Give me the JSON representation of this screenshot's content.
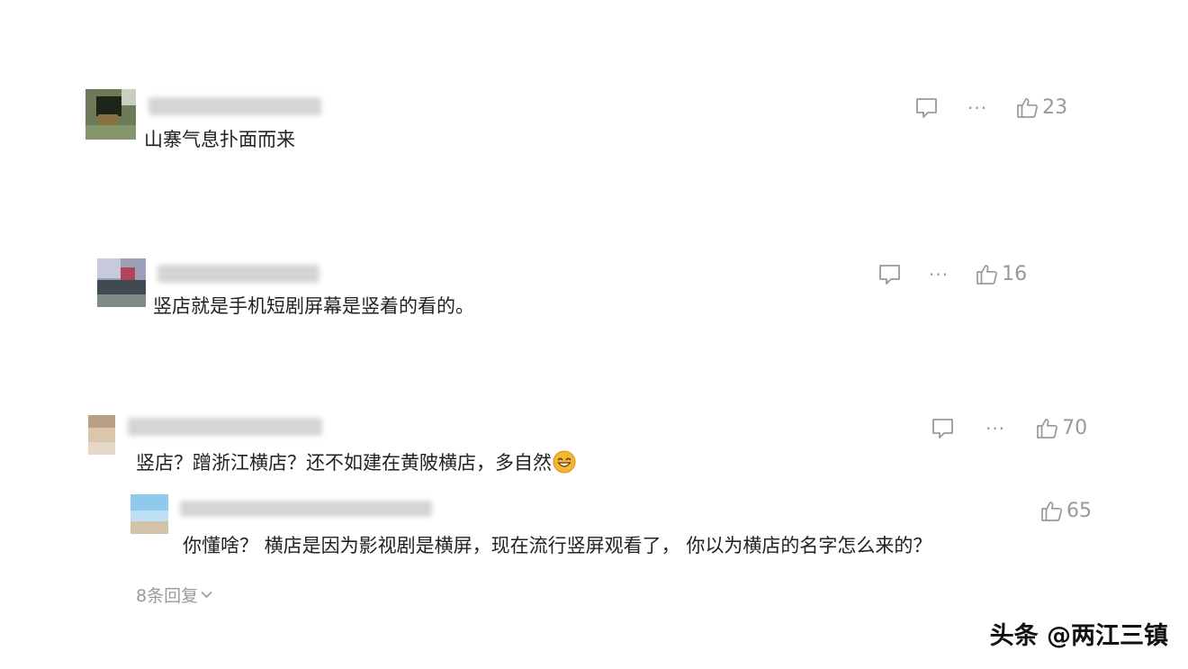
{
  "comments": [
    {
      "text": "山寨气息扑面而来",
      "likes": "23",
      "more_label": "···"
    },
    {
      "text": "竖店就是手机短剧屏幕是竖着的看的。",
      "likes": "16",
      "more_label": "···"
    },
    {
      "text": "竖店？蹭浙江横店？还不如建在黄陂横店，多自然",
      "likes": "70",
      "more_label": "···",
      "emoji": "grinning-face-emoji",
      "reply": {
        "text": "你懂啥？ 横店是因为影视剧是横屏，现在流行竖屏观看了， 你以为横店的名字怎么来的？",
        "likes": "65"
      },
      "more_replies_label": "8条回复"
    }
  ],
  "watermark": "头条 @两江三镇",
  "colors": {
    "text": "#222222",
    "muted": "#999999",
    "background": "#ffffff"
  },
  "icons": [
    "comment-icon",
    "more-icon",
    "thumbs-up-icon",
    "chevron-down-icon"
  ]
}
